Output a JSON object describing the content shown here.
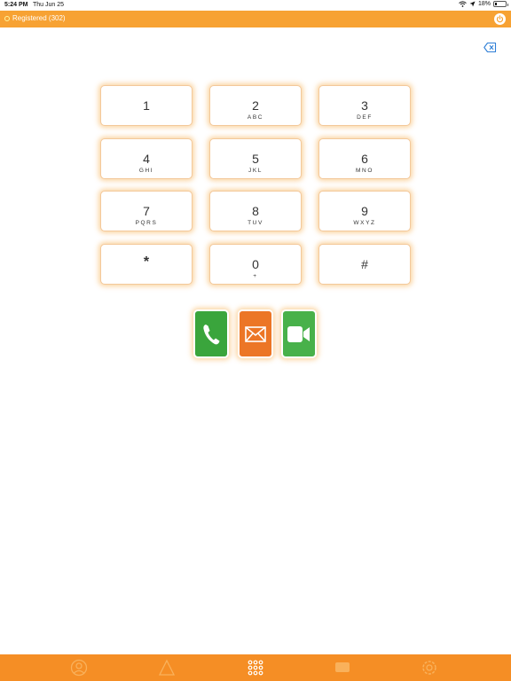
{
  "status_bar": {
    "time": "5:24 PM",
    "date": "Thu Jun 25",
    "battery": "18%",
    "battery_level": 0.18
  },
  "header": {
    "registration": "Registered (302)"
  },
  "keypad": [
    {
      "digit": "1",
      "letters": ""
    },
    {
      "digit": "2",
      "letters": "ABC"
    },
    {
      "digit": "3",
      "letters": "DEF"
    },
    {
      "digit": "4",
      "letters": "GHI"
    },
    {
      "digit": "5",
      "letters": "JKL"
    },
    {
      "digit": "6",
      "letters": "MNO"
    },
    {
      "digit": "7",
      "letters": "PQRS"
    },
    {
      "digit": "8",
      "letters": "TUV"
    },
    {
      "digit": "9",
      "letters": "WXYZ"
    },
    {
      "digit": "*",
      "letters": ""
    },
    {
      "digit": "0",
      "letters": "+"
    },
    {
      "digit": "#",
      "letters": ""
    }
  ],
  "actions": {
    "call": "phone-icon",
    "message": "envelope-icon",
    "video": "video-camera-icon"
  },
  "tabs": [
    {
      "icon": "contacts-icon",
      "selected": false
    },
    {
      "icon": "recents-icon",
      "selected": false
    },
    {
      "icon": "keypad-icon",
      "selected": true
    },
    {
      "icon": "messages-icon",
      "selected": false
    },
    {
      "icon": "settings-icon",
      "selected": false
    }
  ],
  "colors": {
    "accent": "#f7a233",
    "tabbar": "#f58e25",
    "call": "#3aa53c",
    "message": "#ec7626",
    "video": "#48b14a"
  }
}
